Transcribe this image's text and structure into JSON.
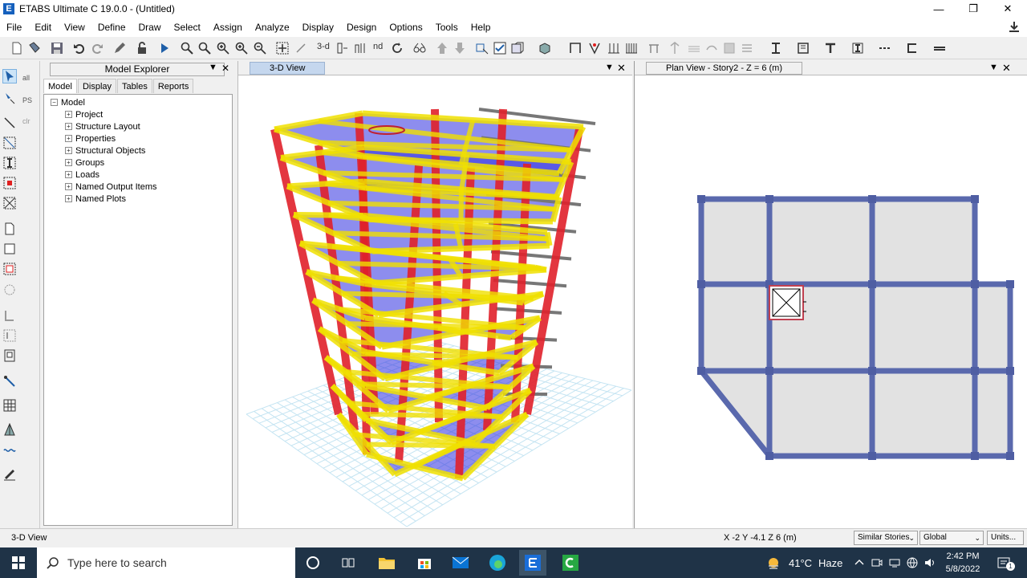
{
  "window": {
    "title": "ETABS Ultimate C 19.0.0 - (Untitled)",
    "logo_letter": "E",
    "minimize": "—",
    "restore": "❐",
    "close": "✕"
  },
  "menu": [
    "File",
    "Edit",
    "View",
    "Define",
    "Draw",
    "Select",
    "Assign",
    "Analyze",
    "Display",
    "Design",
    "Options",
    "Tools",
    "Help"
  ],
  "toolbar": {
    "label_3d": "3-d",
    "label_nd": "nd"
  },
  "left_tools": {
    "all": "all",
    "ps": "PS",
    "clr": "clr"
  },
  "explorer": {
    "title": "Model Explorer",
    "dropdown": "▼",
    "close": "✕",
    "tabs": [
      "Model",
      "Display",
      "Tables",
      "Reports"
    ],
    "root": "Model",
    "items": [
      "Project",
      "Structure Layout",
      "Properties",
      "Structural Objects",
      "Groups",
      "Loads",
      "Named Output Items",
      "Named Plots"
    ]
  },
  "view3d": {
    "tab": "3-D View",
    "dropdown": "▼",
    "close": "✕"
  },
  "planview": {
    "tab": "Plan View - Story2 - Z = 6 (m)",
    "dropdown": "▼",
    "close": "✕"
  },
  "status": {
    "left": "3-D View",
    "coords": "X -2  Y -4.1  Z 6 (m)",
    "stories": "Similar Stories",
    "coord_sys": "Global",
    "units": "Units..."
  },
  "taskbar": {
    "search_placeholder": "Type here to search",
    "temperature": "41°C",
    "weather": "Haze",
    "time": "2:42 PM",
    "date": "5/8/2022",
    "notifications": "1"
  },
  "colors": {
    "column": "#e0202a",
    "beam": "#f0e000",
    "slab": "#3030e0",
    "plan_beam": "#5a69ad",
    "plan_slab": "#e2e2e2"
  }
}
